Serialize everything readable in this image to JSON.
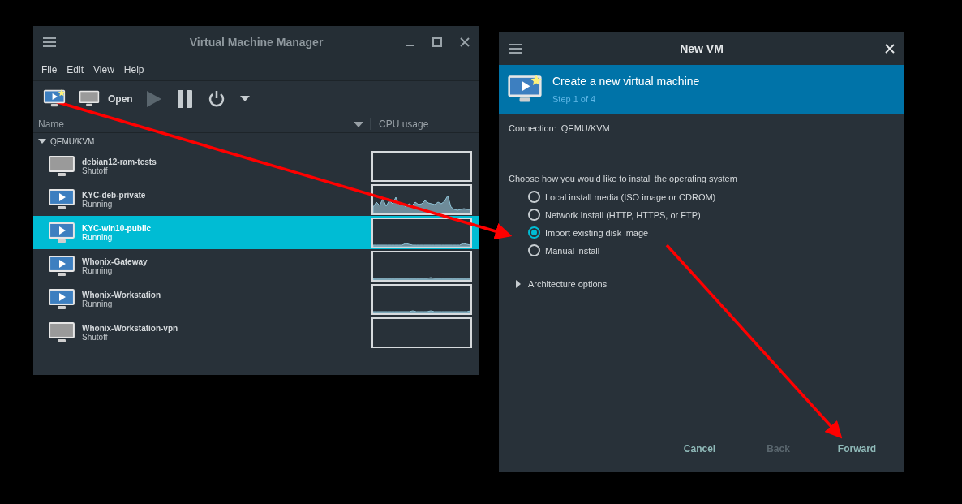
{
  "manager": {
    "title": "Virtual Machine Manager",
    "menu": [
      "File",
      "Edit",
      "View",
      "Help"
    ],
    "toolbar": {
      "open_label": "Open"
    },
    "columns": [
      "Name",
      "CPU usage"
    ],
    "group": {
      "label": "QEMU/KVM",
      "expanded": true
    },
    "vms": [
      {
        "name": "debian12-ram-tests",
        "status": "Shutoff",
        "kind": "shutoff",
        "selected": false
      },
      {
        "name": "KYC-deb-private",
        "status": "Running",
        "kind": "running",
        "selected": false
      },
      {
        "name": "KYC-win10-public",
        "status": "Running",
        "kind": "running",
        "selected": true
      },
      {
        "name": "Whonix-Gateway",
        "status": "Running",
        "kind": "running",
        "selected": false
      },
      {
        "name": "Whonix-Workstation",
        "status": "Running",
        "kind": "running",
        "selected": false
      },
      {
        "name": "Whonix-Workstation-vpn",
        "status": "Shutoff",
        "kind": "shutoff",
        "selected": false
      }
    ]
  },
  "dialog": {
    "title": "New VM",
    "header": {
      "title": "Create a new virtual machine",
      "step": "Step 1 of 4"
    },
    "connection": "Connection:  QEMU/KVM",
    "prompt": "Choose how you would like to install the operating system",
    "options": [
      {
        "label": "Local install media (ISO image or CDROM)",
        "selected": false
      },
      {
        "label": "Network Install (HTTP, HTTPS, or FTP)",
        "selected": false
      },
      {
        "label": "Import existing disk image",
        "selected": true
      },
      {
        "label": "Manual install",
        "selected": false
      }
    ],
    "architecture": {
      "label": "Architecture options",
      "expanded": false
    },
    "buttons": [
      {
        "label": "Cancel",
        "disabled": false
      },
      {
        "label": "Back",
        "disabled": true
      },
      {
        "label": "Forward",
        "disabled": false
      }
    ]
  }
}
